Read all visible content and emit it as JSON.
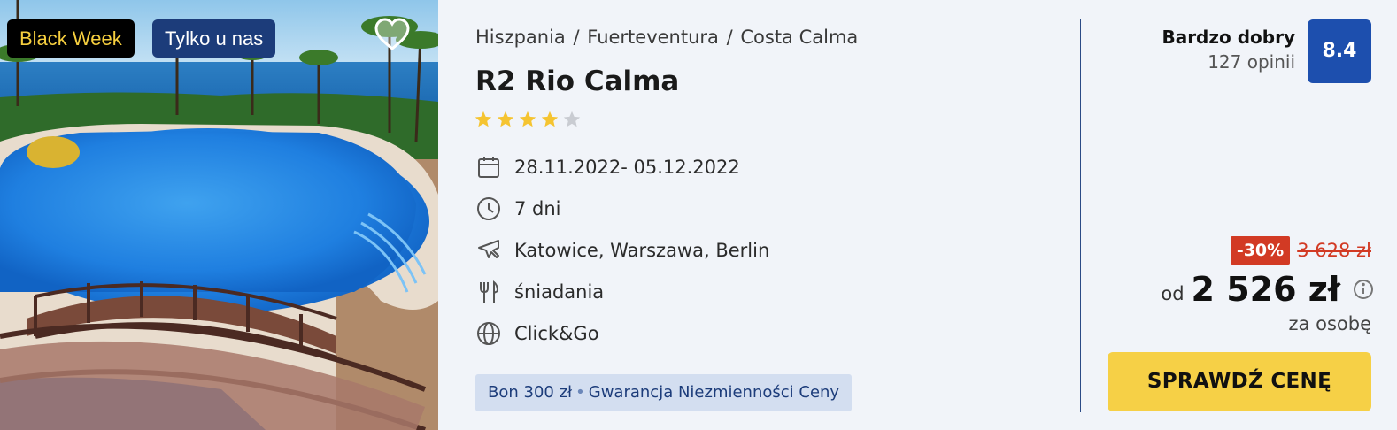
{
  "photo": {
    "badges": [
      {
        "label": "Black Week"
      },
      {
        "label": "Tylko u nas"
      }
    ],
    "favorite_icon": "heart-outline-icon"
  },
  "breadcrumb": {
    "items": [
      "Hiszpania",
      "Fuerteventura",
      "Costa Calma"
    ],
    "separator": "/"
  },
  "hotel": {
    "name": "R2 Rio Calma",
    "stars": 4,
    "max_stars": 5
  },
  "details": [
    {
      "icon": "calendar-icon",
      "text": "28.11.2022- 05.12.2022"
    },
    {
      "icon": "clock-icon",
      "text": "7 dni"
    },
    {
      "icon": "plane-icon",
      "text": "Katowice, Warszawa, Berlin"
    },
    {
      "icon": "cutlery-icon",
      "text": "śniadania"
    },
    {
      "icon": "globe-icon",
      "text": "Click&Go"
    }
  ],
  "promo": {
    "left": "Bon 300 zł",
    "right": "Gwarancja Niezmienności Ceny"
  },
  "rating": {
    "label": "Bardzo dobry",
    "count": "127 opinii",
    "score": "8.4"
  },
  "pricing": {
    "discount": "-30%",
    "old_price": "3 628 zł",
    "from": "od",
    "price": "2 526 zł",
    "per": "za osobę",
    "cta": "SPRAWDŹ CENĘ"
  },
  "colors": {
    "background": "#f1f4f9",
    "brand_blue": "#1d4fae",
    "navy": "#1c3c7a",
    "accent_yellow": "#f6d046",
    "discount_red": "#d23a24",
    "star_yellow": "#f5c431",
    "star_grey": "#c9ccd2"
  }
}
